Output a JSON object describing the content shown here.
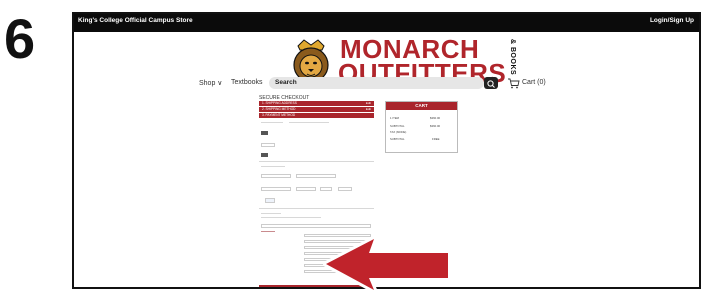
{
  "step_number": "6",
  "topbar": {
    "store_name": "King's College Official Campus Store",
    "login": "Login/Sign Up"
  },
  "brand": {
    "line1": "MONARCH",
    "line2": "OUTFITTERS",
    "side": "& BOOKS"
  },
  "nav": {
    "shop": "Shop ∨",
    "textbooks": "Textbooks",
    "search_label": "Search",
    "cart": "Cart (0)"
  },
  "checkout": {
    "title": "SECURE CHECKOUT",
    "sections": [
      {
        "label": "1. SHIPPING ADDRESS",
        "action": "Edit"
      },
      {
        "label": "2. SHIPPING METHOD",
        "action": "Edit"
      },
      {
        "label": "3. PAYMENT METHOD",
        "action": ""
      }
    ]
  },
  "cart_panel": {
    "title": "CART",
    "rows": [
      {
        "label": "1 ITEM",
        "value": "$360.00"
      },
      {
        "label": "SUBTOTAL",
        "value": "$360.00"
      },
      {
        "label": "TAX (MODE)",
        "value": ""
      },
      {
        "label": "SUBTOTAL",
        "value": "FREE"
      }
    ]
  },
  "colors": {
    "brand_red": "#a9252c",
    "topbar": "#0b0b0b",
    "arrow": "#c0232b"
  }
}
